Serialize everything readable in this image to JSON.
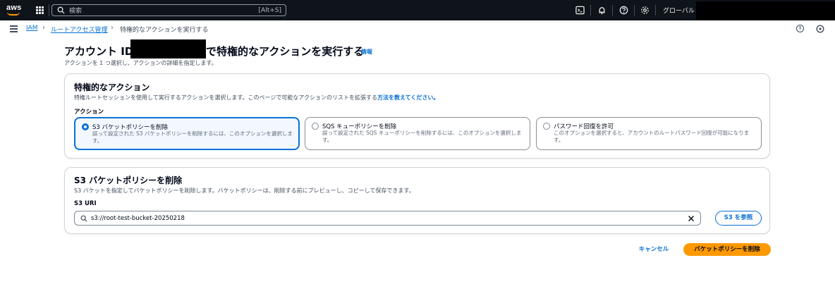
{
  "topbar": {
    "logo_text": "aws",
    "search_placeholder": "検索",
    "search_shortcut": "[Alt+S]",
    "region_label": "グローバル ▾",
    "icons": [
      "cloudshell-icon",
      "bell-icon",
      "help-icon",
      "settings-icon"
    ]
  },
  "breadcrumb": {
    "items": [
      "IAM",
      "ルートアクセス管理",
      "特権的なアクションを実行する"
    ],
    "separator": "›"
  },
  "header": {
    "title_prefix": "アカウント ID",
    "title_suffix": "で特権的なアクションを実行する",
    "info_link": "情報",
    "description": "アクションを 1 つ選択し、アクションの詳細を指定します。"
  },
  "actions_panel": {
    "title": "特権的なアクション",
    "description": "特権ルートセッションを使用して実行するアクションを選択します。このページで可能なアクションのリストを拡張する",
    "description_link": "方法を教えてください。",
    "field_label": "アクション",
    "options": [
      {
        "label": "S3 バケットポリシーを削除",
        "desc": "誤って設定された S3 バケットポリシーを削除するには、このオプションを選択します。",
        "selected": true
      },
      {
        "label": "SQS キューポリシーを削除",
        "desc": "誤って設定された SQS キューポリシーを削除するには、このオプションを選択します。",
        "selected": false
      },
      {
        "label": "パスワード回復を許可",
        "desc": "このオプションを選択すると、アカウントのルートパスワード回復が可能になります。",
        "selected": false
      }
    ]
  },
  "s3_panel": {
    "title": "S3 バケットポリシーを削除",
    "description": "S3 バケットを指定してバケットポリシーを削除します。バケットポリシーは、削除する前にプレビューし、コピーして保存できます。",
    "field_label": "S3 URI",
    "uri_value": "s3://root-test-bucket-20250218",
    "browse_label": "S3 を参照"
  },
  "footer": {
    "cancel_label": "キャンセル",
    "submit_label": "バケットポリシーを削除"
  },
  "colors": {
    "topbar_bg": "#0f141a",
    "link": "#0972d3",
    "primary_button": "#ff9900",
    "selected_tile_bg": "#f2f8fd"
  }
}
